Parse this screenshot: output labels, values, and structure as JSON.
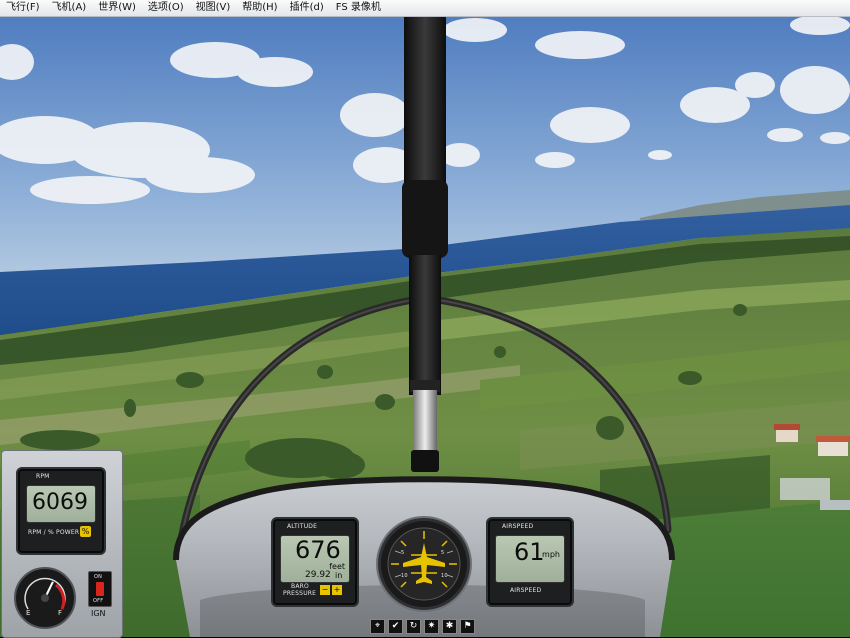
{
  "menu": {
    "items": [
      "飞行(F)",
      "飞机(A)",
      "世界(W)",
      "选项(O)",
      "视图(V)",
      "帮助(H)",
      "插件(d)",
      "FS 录像机"
    ]
  },
  "tach_gauge": {
    "top_label": "RPM",
    "value": "6069",
    "bottom_label": "RPM / % POWER",
    "power_icon": "percent-icon"
  },
  "fuel_gauge": {
    "left_mark": "E",
    "right_mark": "F",
    "level": 0.6
  },
  "ignition": {
    "on_label": "ON",
    "off_label": "OFF",
    "caption": "IGN"
  },
  "altimeter": {
    "top_label": "ALTITUDE",
    "value": "676",
    "unit": "feet",
    "baro_value": "29.92",
    "baro_unit": "in",
    "baro_label_1": "BARO",
    "baro_label_2": "PRESSURE"
  },
  "airspeed": {
    "top_label": "AIRSPEED",
    "value": "61",
    "unit": "mph",
    "bottom_label": "AIRSPEED"
  },
  "attitude": {
    "ticks": [
      "5",
      "5",
      "10",
      "10"
    ]
  },
  "toolbar": {
    "icons": [
      "gps-icon",
      "checklist-icon",
      "kneeboard-icon",
      "atc-icon",
      "map-icon",
      "tower-icon"
    ]
  },
  "colors": {
    "sky_top": "#5a84c4",
    "sea": "#2d5fa3",
    "lcd": "#a9b8a4",
    "attitude_yellow": "#e6c200"
  }
}
